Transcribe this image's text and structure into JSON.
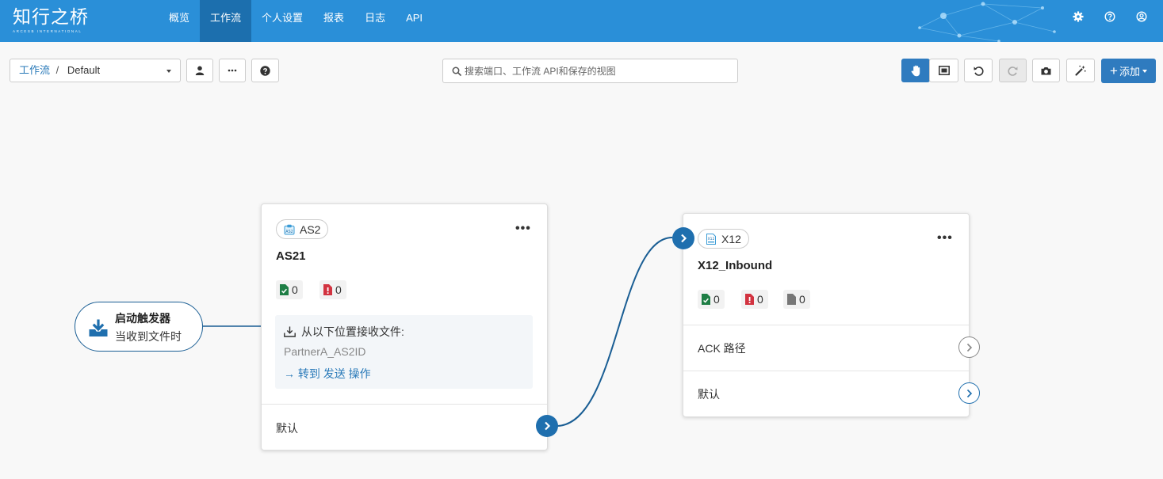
{
  "app": {
    "logo_text": "知行之桥",
    "logo_subtext": "ARCESB INTERNATIONAL"
  },
  "nav": {
    "items": [
      {
        "label": "概览"
      },
      {
        "label": "工作流",
        "active": true
      },
      {
        "label": "个人设置"
      },
      {
        "label": "报表"
      },
      {
        "label": "日志"
      },
      {
        "label": "API"
      }
    ]
  },
  "header_icons": [
    "gear-icon",
    "help-icon",
    "user-icon"
  ],
  "toolbar": {
    "breadcrumb_root": "工作流",
    "breadcrumb_separator": "/",
    "breadcrumb_current": "Default",
    "search_placeholder": "搜索端口、工作流 API和保存的视图",
    "add_label": "添加"
  },
  "colors": {
    "nav_bg": "#2a8fd8",
    "nav_active": "#1c6fae",
    "primary": "#2f7bbf",
    "edge": "#1a5e94",
    "success": "#28a745",
    "danger": "#dc3545"
  },
  "trigger": {
    "title": "启动触发器",
    "subtitle": "当收到文件时"
  },
  "nodes": {
    "as2": {
      "type_label": "AS2",
      "title": "AS21",
      "success_count": "0",
      "error_count": "0",
      "info_heading": "从以下位置接收文件:",
      "info_partner": "PartnerA_AS2ID",
      "info_link_arrow": "→",
      "info_link": "转到 发送 操作",
      "output_label": "默认"
    },
    "x12": {
      "type_label": "X12",
      "title": "X12_Inbound",
      "success_count": "0",
      "error_count": "0",
      "pending_count": "0",
      "ack_label": "ACK 路径",
      "output_label": "默认"
    }
  }
}
